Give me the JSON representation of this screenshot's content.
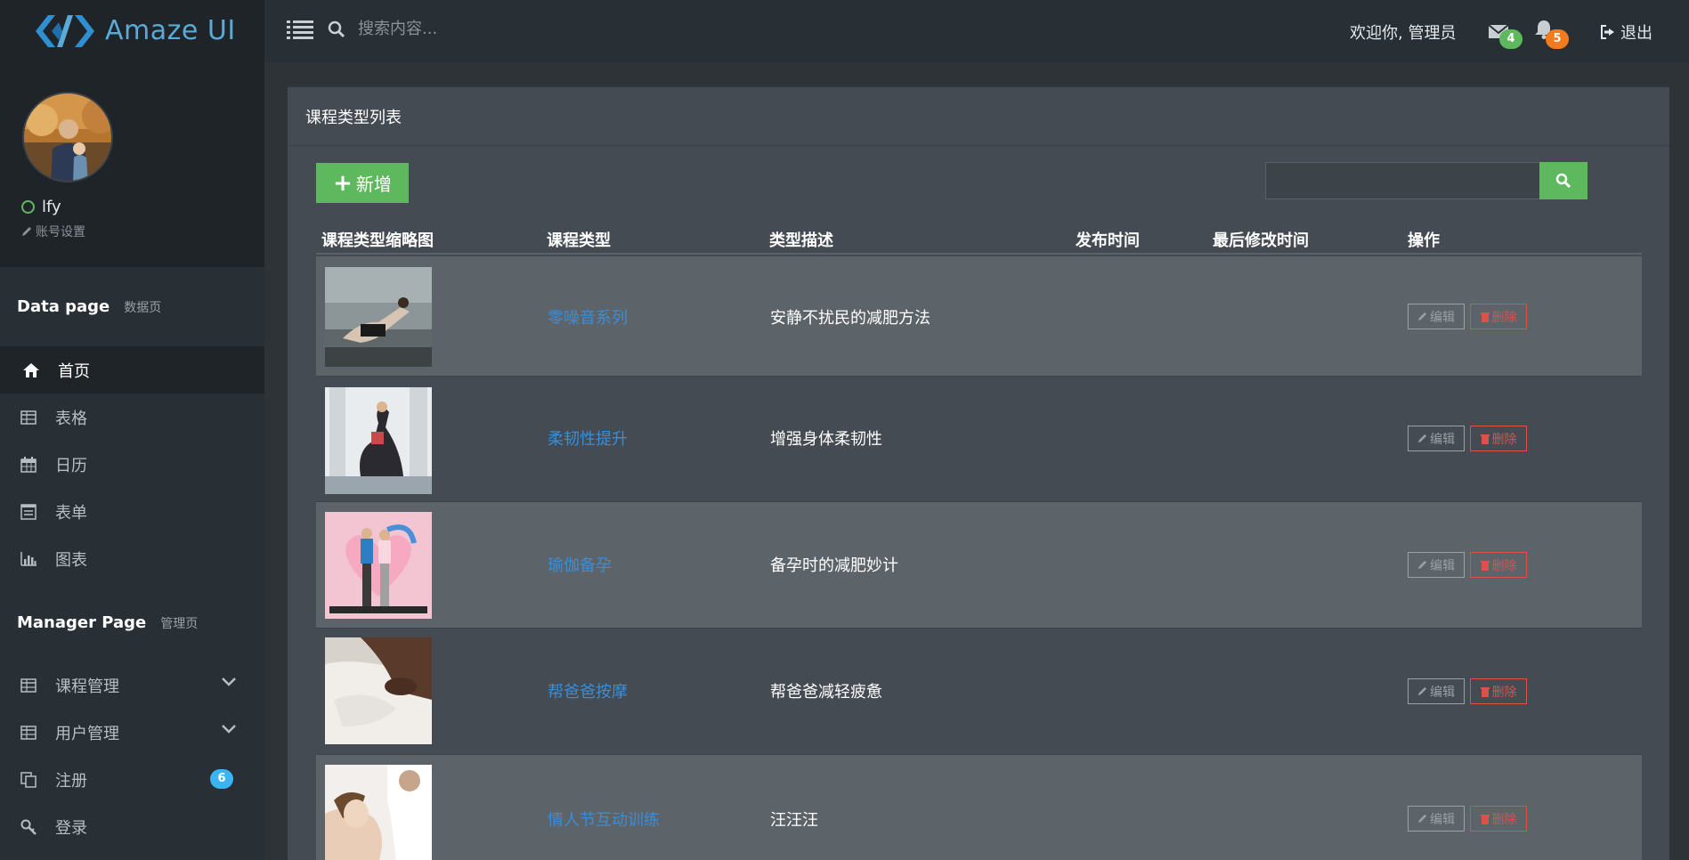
{
  "header": {
    "logo_text": "Amaze UI",
    "search_placeholder": "搜索内容...",
    "welcome": "欢迎你, 管理员",
    "mail_count": "4",
    "notify_count": "5",
    "logout": "退出"
  },
  "profile": {
    "username": "lfy",
    "account_settings": "账号设置"
  },
  "sidebar": {
    "data_section": {
      "title": "Data page",
      "subtitle": "数据页"
    },
    "data_items": [
      {
        "label": "首页",
        "icon": "home-icon"
      },
      {
        "label": "表格",
        "icon": "table-icon"
      },
      {
        "label": "日历",
        "icon": "calendar-icon"
      },
      {
        "label": "表单",
        "icon": "form-icon"
      },
      {
        "label": "图表",
        "icon": "bar-chart-icon"
      }
    ],
    "manager_section": {
      "title": "Manager Page",
      "subtitle": "管理页"
    },
    "manager_items": [
      {
        "label": "课程管理",
        "icon": "table-icon"
      },
      {
        "label": "用户管理",
        "icon": "table-icon"
      },
      {
        "label": "注册",
        "icon": "copy-icon",
        "badge": "6"
      },
      {
        "label": "登录",
        "icon": "key-icon"
      }
    ]
  },
  "panel": {
    "title": "课程类型列表",
    "add_label": "新增",
    "search_value": ""
  },
  "table": {
    "headers": [
      "课程类型缩略图",
      "课程类型",
      "类型描述",
      "发布时间",
      "最后修改时间",
      "操作"
    ],
    "edit_label": "编辑",
    "delete_label": "删除",
    "rows": [
      {
        "type": "零噪音系列",
        "desc": "安静不扰民的减肥方法",
        "publish": "",
        "modified": ""
      },
      {
        "type": "柔韧性提升",
        "desc": "增强身体柔韧性",
        "publish": "",
        "modified": ""
      },
      {
        "type": "瑜伽备孕",
        "desc": "备孕时的减肥妙计",
        "publish": "",
        "modified": ""
      },
      {
        "type": "帮爸爸按摩",
        "desc": "帮爸爸减轻疲惫",
        "publish": "",
        "modified": ""
      },
      {
        "type": "情人节互动训练",
        "desc": "汪汪汪",
        "publish": "",
        "modified": ""
      }
    ]
  },
  "colors": {
    "accent_green": "#5eb95e",
    "badge_orange": "#f37b1d",
    "badge_blue": "#3bb4f2",
    "danger_red": "#dd514c",
    "link_blue": "#3a8ed8"
  }
}
